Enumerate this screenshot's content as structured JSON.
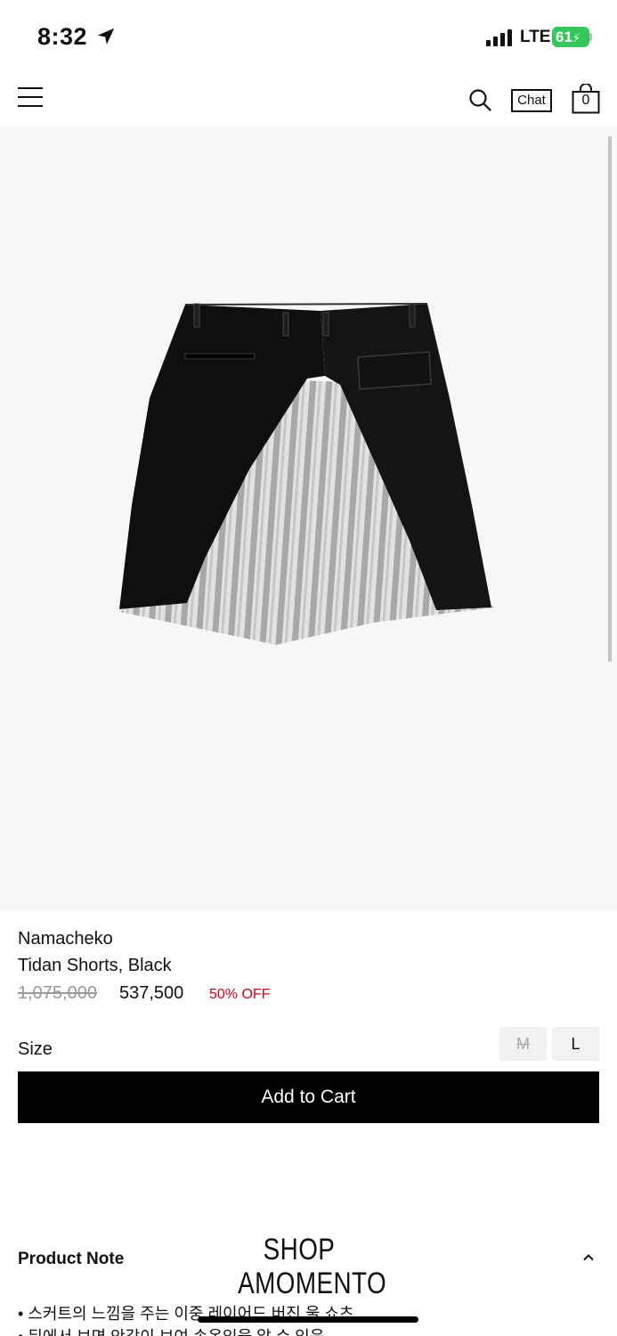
{
  "status_bar": {
    "time": "8:32",
    "network": "LTE",
    "battery": "61"
  },
  "header": {
    "chat_label": "Chat",
    "cart_count": "0",
    "icons": [
      "menu-icon",
      "search-icon",
      "shopping-bag-icon"
    ]
  },
  "product": {
    "brand": "Namacheko",
    "name": "Tidan Shorts, Black",
    "original_price": "1,075,000",
    "sale_price": "537,500",
    "discount": "50% OFF",
    "discount_color": "#d0021b"
  },
  "size": {
    "label": "Size",
    "options": [
      {
        "label": "M",
        "available": false
      },
      {
        "label": "L",
        "available": true
      }
    ]
  },
  "add_to_cart_label": "Add to Cart",
  "product_note": {
    "title": "Product Note",
    "lines": [
      "• 스커트의 느낌을 주는 이중 레이어드 버진 울 쇼츠",
      "• 뒤에서 보면 안감이 보여 속옷임을 알 수 있음"
    ]
  },
  "shop_logo": {
    "line1": "SHOP",
    "line2": "AMOMENTO"
  }
}
